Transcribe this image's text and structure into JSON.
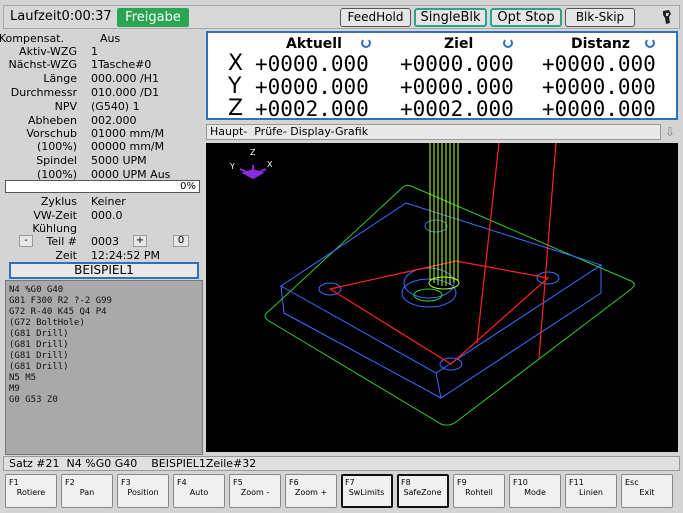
{
  "topbar": {
    "runtime": "Laufzeit0:00:37",
    "enable": "Freigabe",
    "buttons": {
      "feedhold": "FeedHold",
      "singleblk": "SingleBlk",
      "optstop": "Opt Stop",
      "blkskip": "Blk-Skip"
    }
  },
  "info": {
    "kompensat_label": "Kompensat.",
    "kompensat_value": "Aus",
    "aktiv_label": "Aktiv-WZG",
    "aktiv_value": "1",
    "naechst_label": "Nächst-WZG",
    "naechst_value": "1Tasche#0",
    "laenge_label": "Länge",
    "laenge_value": "000.000 /H1",
    "durchm_label": "Durchmessr",
    "durchm_value": "010.000 /D1",
    "npv_label": "NPV",
    "npv_value": "(G540) 1",
    "abheben_label": "Abheben",
    "abheben_value": "002.000",
    "vorschub_label": "Vorschub",
    "vorschub_value": "01000 mm/M",
    "vorschub_pct_label": "(100%)",
    "vorschub_pct_value": "00000 mm/M",
    "spindel_label": "Spindel",
    "spindel_value": "5000 UPM",
    "spindel_pct_label": "(100%)",
    "spindel_pct_value": "0000 UPM Aus",
    "progress": "0%",
    "zyklus_label": "Zyklus",
    "zyklus_value": "Keiner",
    "vwzeit_label": "VW-Zeit",
    "vwzeit_value": "000.0",
    "kuehlung_label": "Kühlung",
    "kuehlung_value": "",
    "teil_minus": "-",
    "teil_label": "Teil #",
    "teil_value": "0003",
    "teil_plus": "+",
    "teil_count": "0",
    "zeit_label": "Zeit",
    "zeit_value": "12:24:52 PM",
    "program": "BEISPIEL1"
  },
  "gcode": [
    "N4 %G0 G40",
    "G81 F300 R2 ?-2 G99",
    "G72 R-40 K45 Q4 P4",
    "(G72 BoltHole)",
    "(G81 Drill)",
    "(G81 Drill)",
    "(G81 Drill)",
    "(G81 Drill)",
    "N5 M5",
    "M9",
    "G0 G53 Z0"
  ],
  "dro": {
    "headers": {
      "aktuell": "Aktuell",
      "ziel": "Ziel",
      "distanz": "Distanz"
    },
    "axes": [
      {
        "name": "X",
        "aktuell": "+0000.000",
        "ziel": "+0000.000",
        "distanz": "+0000.000"
      },
      {
        "name": "Y",
        "aktuell": "+0000.000",
        "ziel": "+0000.000",
        "distanz": "+0000.000"
      },
      {
        "name": "Z",
        "aktuell": "+0002.000",
        "ziel": "+0002.000",
        "distanz": "+0000.000"
      }
    ]
  },
  "tabs": "Haupt-  Prüfe- Display-Grafik",
  "tabs_arrow": "⇩",
  "viewport": {
    "axis_y": "Y",
    "axis_z": "Z",
    "axis_x": "X"
  },
  "status": "Satz #21  N4 %G0 G40    BEISPIEL1Zeile#32",
  "fkeys": [
    {
      "key": "F1",
      "label": "Rotiere"
    },
    {
      "key": "F2",
      "label": "Pan"
    },
    {
      "key": "F3",
      "label": "Position"
    },
    {
      "key": "F4",
      "label": "Auto"
    },
    {
      "key": "F5",
      "label": "Zoom -"
    },
    {
      "key": "F6",
      "label": "Zoom +"
    },
    {
      "key": "F7",
      "label": "SwLimits"
    },
    {
      "key": "F8",
      "label": "SafeZone"
    },
    {
      "key": "F9",
      "label": "Rohteil"
    },
    {
      "key": "F10",
      "label": "Mode"
    },
    {
      "key": "F11",
      "label": "Linien"
    },
    {
      "key": "Esc",
      "label": "Exit"
    }
  ],
  "colors": {
    "accent": "#2f6fbf",
    "enable": "#2aa552",
    "toggle": "#2aa58c"
  },
  "icons": {
    "tool": "tool-holder-icon",
    "refresh": "refresh-icon"
  }
}
